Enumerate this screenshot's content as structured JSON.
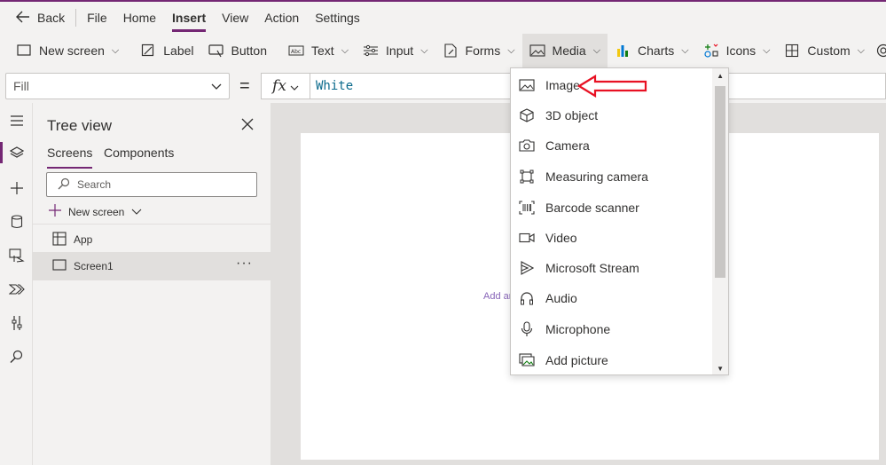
{
  "menubar": {
    "back_label": "Back",
    "items": [
      {
        "label": "File",
        "active": false
      },
      {
        "label": "Home",
        "active": false
      },
      {
        "label": "Insert",
        "active": true
      },
      {
        "label": "View",
        "active": false
      },
      {
        "label": "Action",
        "active": false
      },
      {
        "label": "Settings",
        "active": false
      }
    ]
  },
  "ribbon": {
    "new_screen": "New screen",
    "label": "Label",
    "button": "Button",
    "text": "Text",
    "input": "Input",
    "forms": "Forms",
    "media": "Media",
    "charts": "Charts",
    "icons": "Icons",
    "custom": "Custom"
  },
  "formula": {
    "property": "Fill",
    "equals": "=",
    "fx": "fx",
    "value": "White"
  },
  "tree": {
    "title": "Tree view",
    "tabs": [
      "Screens",
      "Components"
    ],
    "search_placeholder": "Search",
    "new_screen": "New screen",
    "nodes": [
      {
        "label": "App",
        "selected": false
      },
      {
        "label": "Screen1",
        "selected": true
      }
    ],
    "more": "···"
  },
  "canvas": {
    "hint": "Add an"
  },
  "media_menu": {
    "items": [
      {
        "label": "Image",
        "icon": "image-icon"
      },
      {
        "label": "3D object",
        "icon": "cube-icon"
      },
      {
        "label": "Camera",
        "icon": "camera-icon"
      },
      {
        "label": "Measuring camera",
        "icon": "measuring-camera-icon"
      },
      {
        "label": "Barcode scanner",
        "icon": "barcode-icon"
      },
      {
        "label": "Video",
        "icon": "video-icon"
      },
      {
        "label": "Microsoft Stream",
        "icon": "stream-icon"
      },
      {
        "label": "Audio",
        "icon": "headphones-icon"
      },
      {
        "label": "Microphone",
        "icon": "microphone-icon"
      },
      {
        "label": "Add picture",
        "icon": "add-picture-icon"
      }
    ]
  },
  "colors": {
    "accent": "#742774",
    "callout_arrow": "#e81123"
  }
}
